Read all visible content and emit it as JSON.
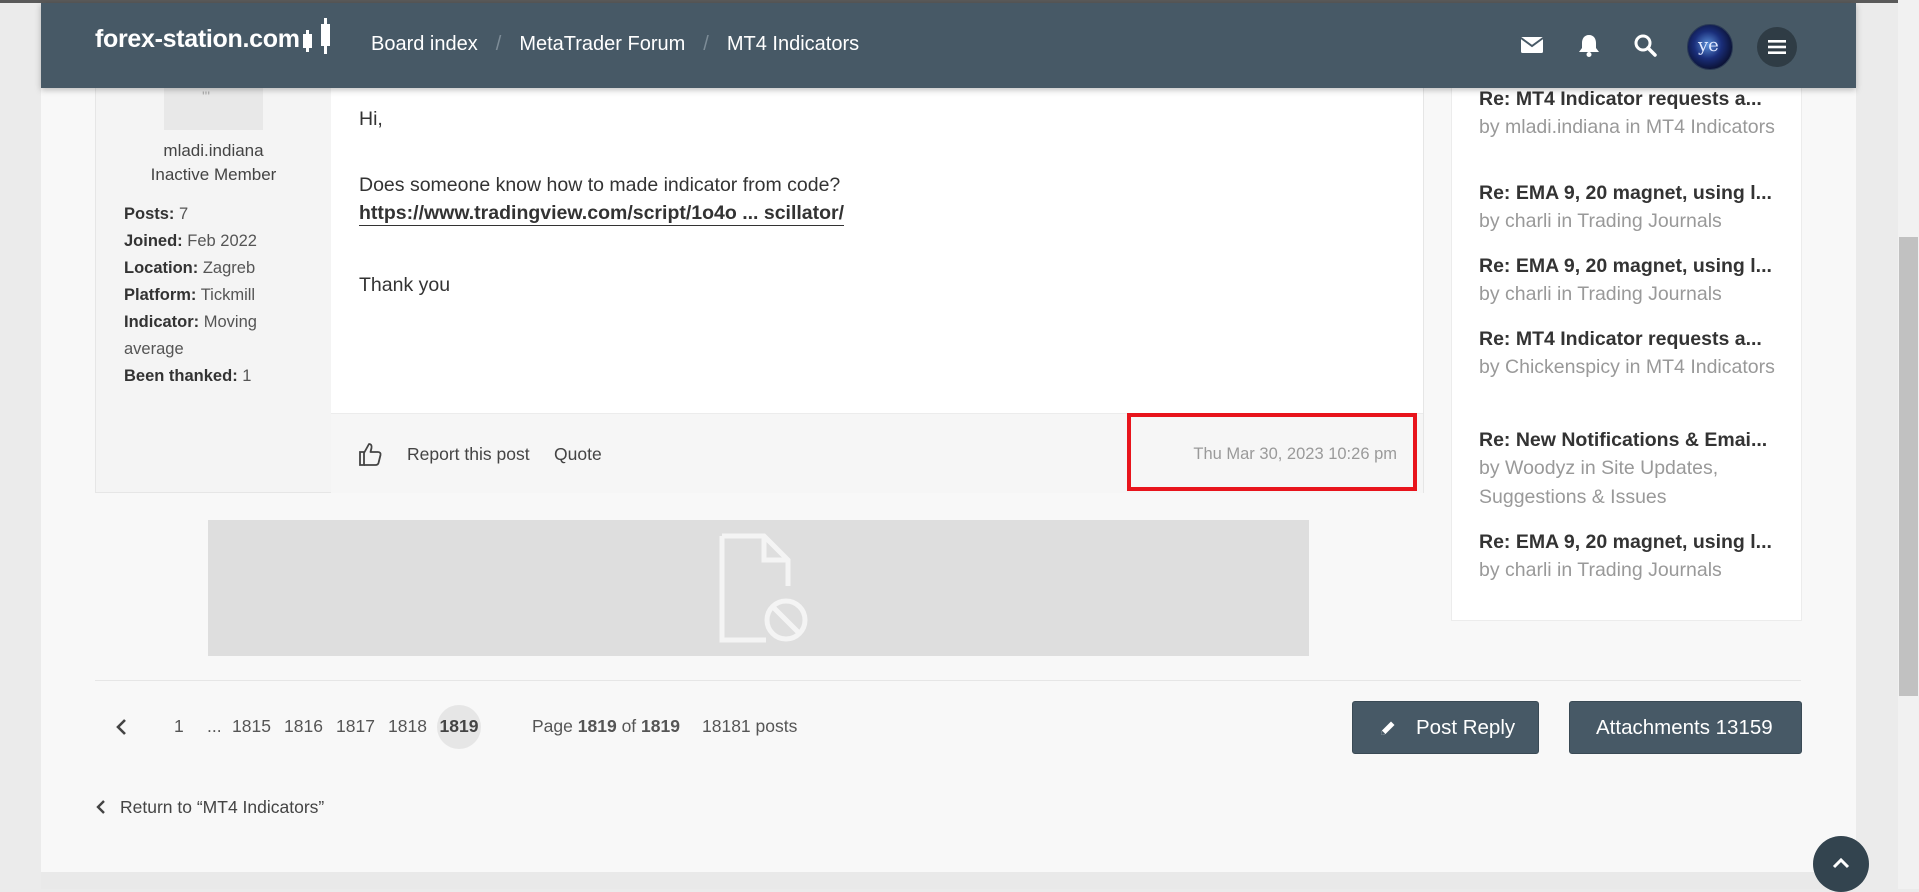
{
  "header": {
    "site_name": "forex-station.com",
    "breadcrumbs": [
      "Board index",
      "MetaTrader Forum",
      "MT4 Indicators"
    ],
    "avatar_text": "ye"
  },
  "post": {
    "author": {
      "username": "mladi.indiana",
      "rank": "Inactive Member",
      "avatar_placeholder": "'''",
      "stats": [
        {
          "label": "Posts:",
          "value": "7"
        },
        {
          "label": "Joined:",
          "value": "Feb 2022"
        },
        {
          "label": "Location:",
          "value": "Zagreb"
        },
        {
          "label": "Platform:",
          "value": "Tickmill"
        },
        {
          "label": "Indicator:",
          "value": "Moving average"
        },
        {
          "label": "Been thanked:",
          "value": "1"
        }
      ]
    },
    "greeting": "Hi,",
    "body": "Does someone know how to made indicator from code?",
    "link": "https://www.tradingview.com/script/1o4o ... scillator/",
    "closing": "Thank you",
    "actions": {
      "report": "Report this post",
      "quote": "Quote"
    },
    "timestamp": "Thu Mar 30, 2023 10:26 pm"
  },
  "sidebar": {
    "items": [
      {
        "title": "Re: MT4 Indicator requests a...",
        "meta": "by mladi.indiana in MT4 Indicators"
      },
      {
        "title": "Re: EMA 9, 20 magnet, using l...",
        "meta": "by charli in Trading Journals"
      },
      {
        "title": "Re: EMA 9, 20 magnet, using l...",
        "meta": "by charli in Trading Journals"
      },
      {
        "title": "Re: MT4 Indicator requests a...",
        "meta": "by Chickenspicy in MT4 Indicators"
      },
      {
        "title": "Re: New Notifications & Emai...",
        "meta": "by Woodyz in Site Updates, Suggestions & Issues"
      },
      {
        "title": "Re: EMA 9, 20 magnet, using l...",
        "meta": "by charli in Trading Journals"
      }
    ]
  },
  "pagination": {
    "pages": [
      "1",
      "...",
      "1815",
      "1816",
      "1817",
      "1818"
    ],
    "current": "1819",
    "page_word": "Page",
    "of_word": "of",
    "page_current": "1819",
    "page_total": "1819",
    "posts": "18181 posts"
  },
  "buttons": {
    "post_reply": "Post Reply",
    "attachments": "Attachments 13159"
  },
  "return_link": "Return to “MT4 Indicators”"
}
